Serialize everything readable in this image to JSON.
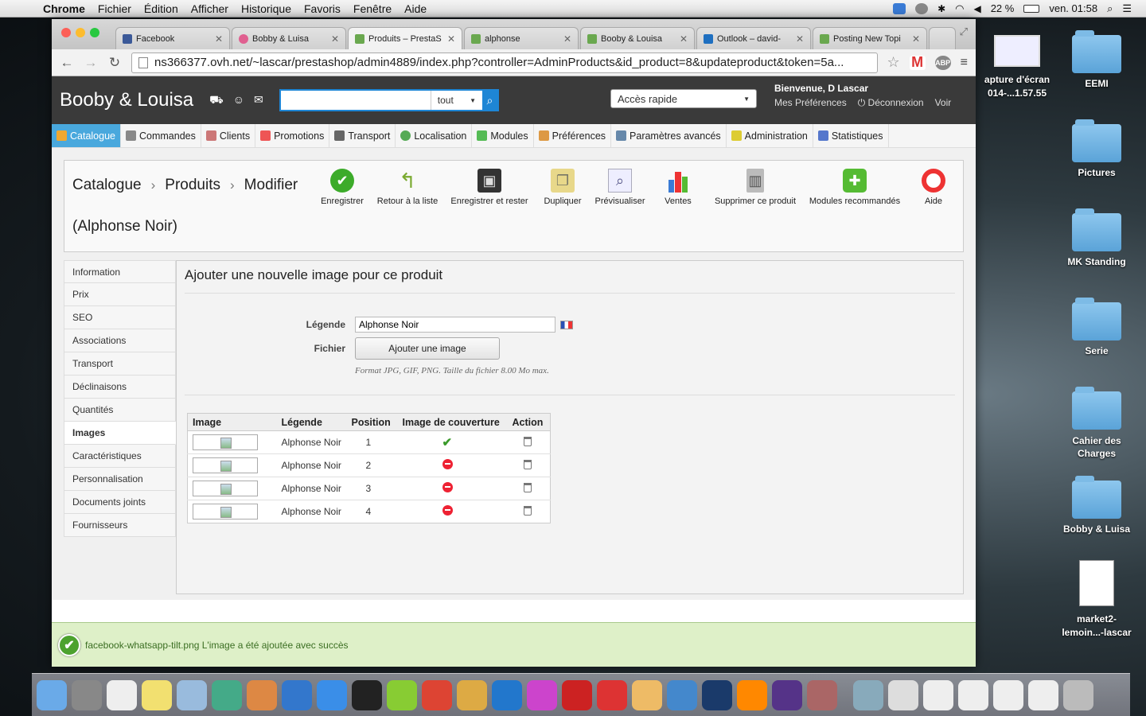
{
  "menubar": {
    "app": "Chrome",
    "items": [
      "Fichier",
      "Édition",
      "Afficher",
      "Historique",
      "Favoris",
      "Fenêtre",
      "Aide"
    ],
    "battery": "22 %",
    "clock": "ven. 01:58"
  },
  "desktop": {
    "items": [
      {
        "label": "apture d'écran\n014-...1.57.55"
      },
      {
        "label": "EEMI"
      },
      {
        "label": "Pictures"
      },
      {
        "label": "MK Standing"
      },
      {
        "label": "Serie"
      },
      {
        "label": "Cahier des Charges"
      },
      {
        "label": "Bobby & Luisa"
      },
      {
        "label": "market2-\nlemoin...-lascar"
      }
    ]
  },
  "browser": {
    "tabs": [
      {
        "title": "Facebook",
        "color": "#3b5998"
      },
      {
        "title": "Bobby & Luisa",
        "color": "#e06090"
      },
      {
        "title": "Produits – PrestaS",
        "color": "#6aa84f"
      },
      {
        "title": "alphonse",
        "color": "#6aa84f"
      },
      {
        "title": "Booby & Louisa",
        "color": "#6aa84f"
      },
      {
        "title": "Outlook – david-",
        "color": "#1e6fc0"
      },
      {
        "title": "Posting New Topi",
        "color": "#6aa84f"
      }
    ],
    "url": "ns366377.ovh.net/~lascar/prestashop/admin4889/index.php?controller=AdminProducts&id_product=8&updateproduct&token=5a..."
  },
  "header": {
    "shop_name": "Booby & Louisa",
    "search_select": "tout",
    "quick_access": "Accès rapide",
    "welcome": "Bienvenue, D Lascar",
    "preferences": "Mes Préférences",
    "logout": "Déconnexion",
    "view": "Voir"
  },
  "nav": {
    "items": [
      {
        "label": "Catalogue",
        "color": "#f0a830"
      },
      {
        "label": "Commandes",
        "color": "#888"
      },
      {
        "label": "Clients",
        "color": "#c77"
      },
      {
        "label": "Promotions",
        "color": "#e55"
      },
      {
        "label": "Transport",
        "color": "#666"
      },
      {
        "label": "Localisation",
        "color": "#5a5"
      },
      {
        "label": "Modules",
        "color": "#5b5"
      },
      {
        "label": "Préférences",
        "color": "#d94"
      },
      {
        "label": "Paramètres avancés",
        "color": "#68a"
      },
      {
        "label": "Administration",
        "color": "#dc3"
      },
      {
        "label": "Statistiques",
        "color": "#57c"
      }
    ]
  },
  "breadcrumb": {
    "level1": "Catalogue",
    "level2": "Produits",
    "level3": "Modifier",
    "subtitle": "(Alphonse Noir)"
  },
  "toolbar": {
    "buttons": [
      {
        "label": "Enregistrer",
        "icon": "check-icon",
        "glyph": "✔",
        "bg": "#3cab2a"
      },
      {
        "label": "Retour à la liste",
        "icon": "back-arrow-icon",
        "glyph": "↰",
        "bg": "#8fbe3c"
      },
      {
        "label": "Enregistrer et rester",
        "icon": "floppy-icon",
        "glyph": "▣",
        "bg": "#333"
      },
      {
        "label": "Dupliquer",
        "icon": "duplicate-icon",
        "glyph": "❐",
        "bg": "#e8d88a"
      },
      {
        "label": "Prévisualiser",
        "icon": "preview-icon",
        "glyph": "⌕",
        "bg": "#ccd"
      },
      {
        "label": "Ventes",
        "icon": "bar-chart-icon",
        "glyph": "▮",
        "bg": "#e33"
      },
      {
        "label": "Supprimer ce produit",
        "icon": "trash-icon",
        "glyph": "🗑",
        "bg": "#999"
      },
      {
        "label": "Modules recommandés",
        "icon": "puzzle-icon",
        "glyph": "✚",
        "bg": "#5b3"
      },
      {
        "label": "Aide",
        "icon": "lifebuoy-icon",
        "glyph": "◎",
        "bg": "#e33"
      }
    ]
  },
  "sidemenu": {
    "items": [
      "Information",
      "Prix",
      "SEO",
      "Associations",
      "Transport",
      "Déclinaisons",
      "Quantités",
      "Images",
      "Caractéristiques",
      "Personnalisation",
      "Documents joints",
      "Fournisseurs"
    ],
    "active": "Images"
  },
  "panel": {
    "title": "Ajouter une nouvelle image pour ce produit",
    "legend_label": "Légende",
    "legend_value": "Alphonse Noir",
    "file_label": "Fichier",
    "upload_button": "Ajouter une image",
    "format_hint": "Format JPG, GIF, PNG. Taille du fichier 8.00 Mo max."
  },
  "table": {
    "headers": [
      "Image",
      "Légende",
      "Position",
      "Image de couverture",
      "Action"
    ],
    "rows": [
      {
        "legend": "Alphonse Noir",
        "position": "1",
        "cover": true
      },
      {
        "legend": "Alphonse Noir",
        "position": "2",
        "cover": false
      },
      {
        "legend": "Alphonse Noir",
        "position": "3",
        "cover": false
      },
      {
        "legend": "Alphonse Noir",
        "position": "4",
        "cover": false
      }
    ]
  },
  "notification": "facebook-whatsapp-tilt.png L'image a été ajoutée avec succès",
  "dock": {
    "apps": [
      {
        "name": "finder",
        "color": "#6aaae8"
      },
      {
        "name": "launchpad",
        "color": "#888"
      },
      {
        "name": "calendar",
        "color": "#eee"
      },
      {
        "name": "stickies",
        "color": "#f2e070"
      },
      {
        "name": "preview",
        "color": "#9bd"
      },
      {
        "name": "iphoto",
        "color": "#4a8"
      },
      {
        "name": "picasa",
        "color": "#d84"
      },
      {
        "name": "itunes",
        "color": "#37c"
      },
      {
        "name": "app-store",
        "color": "#3a8ee8"
      },
      {
        "name": "audio-app",
        "color": "#222"
      },
      {
        "name": "android",
        "color": "#8c3"
      },
      {
        "name": "powerpoint",
        "color": "#d43"
      },
      {
        "name": "chrome",
        "color": "#da4"
      },
      {
        "name": "word",
        "color": "#27c"
      },
      {
        "name": "stats-app",
        "color": "#c4c"
      },
      {
        "name": "filezilla",
        "color": "#c22"
      },
      {
        "name": "star-app",
        "color": "#d33"
      },
      {
        "name": "notes-app",
        "color": "#eb6"
      },
      {
        "name": "keynote",
        "color": "#48c"
      },
      {
        "name": "photoshop",
        "color": "#1a3a6a"
      },
      {
        "name": "vlc",
        "color": "#f80"
      },
      {
        "name": "imovie",
        "color": "#538"
      },
      {
        "name": "photo-booth",
        "color": "#a66"
      },
      {
        "name": "applications-folder",
        "color": "#8ab"
      },
      {
        "name": "documents-1",
        "color": "#ddd"
      },
      {
        "name": "documents-2",
        "color": "#eee"
      },
      {
        "name": "documents-3",
        "color": "#eee"
      },
      {
        "name": "documents-4",
        "color": "#eee"
      },
      {
        "name": "documents-5",
        "color": "#eee"
      },
      {
        "name": "trash",
        "color": "#bbb"
      }
    ]
  }
}
